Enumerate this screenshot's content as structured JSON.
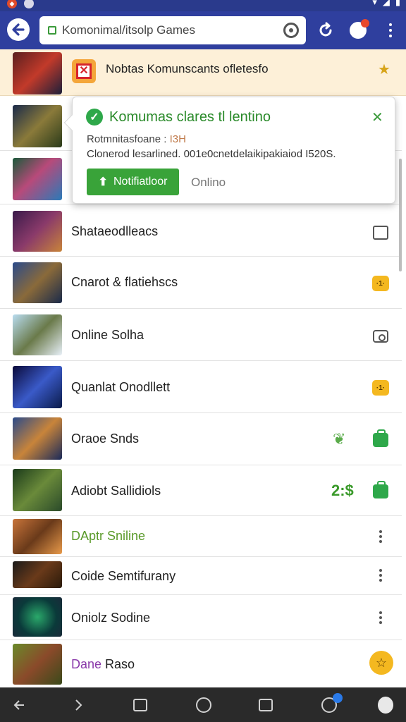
{
  "browser": {
    "url": "Komonimal/itsolp Games"
  },
  "banner": {
    "text": "Nobtas Komunscants ofletesfo"
  },
  "popup": {
    "title": "Komumas clares tl lentino",
    "subtitle": "Rotmnitasfoane :",
    "subtitle_tag": "I3H",
    "body": "Clonerod lesarlined. 001e0cnetdelaikipakiaiod I520S.",
    "primary_button": "Notifiatloor",
    "secondary_link": "Onlino"
  },
  "list": {
    "items": [
      {
        "label": "",
        "icon": "none"
      },
      {
        "label": "",
        "icon": "none"
      },
      {
        "label": "Shataeodlleacs",
        "icon": "square-icon"
      },
      {
        "label": "Cnarot & flatiehscs",
        "icon": "ticket-icon",
        "icon_text": "·1·"
      },
      {
        "label": "Online Solha",
        "icon": "camera-icon"
      },
      {
        "label": "Quanlat Onodllett",
        "icon": "ticket-icon",
        "icon_text": "·1·"
      },
      {
        "label": "Oraoe Snds",
        "icon": "bag-icon"
      },
      {
        "label": "Adiobt Sallidiols",
        "icon": "bag-icon",
        "price": "2:$"
      },
      {
        "label": "DAptr Sniline",
        "icon": "kebab-icon"
      },
      {
        "label": "Coide Semtifurany",
        "icon": "kebab-icon"
      },
      {
        "label": "Oniolz Sodine",
        "icon": "kebab-icon"
      },
      {
        "label_part1": "Dane",
        "label_part2": "Raso",
        "icon": "star-icon"
      }
    ]
  },
  "colors": {
    "header": "#2f3f9e",
    "accent_green": "#39a339",
    "banner_bg": "#fdf0d8",
    "bottom_nav": "#2a2a2a"
  }
}
